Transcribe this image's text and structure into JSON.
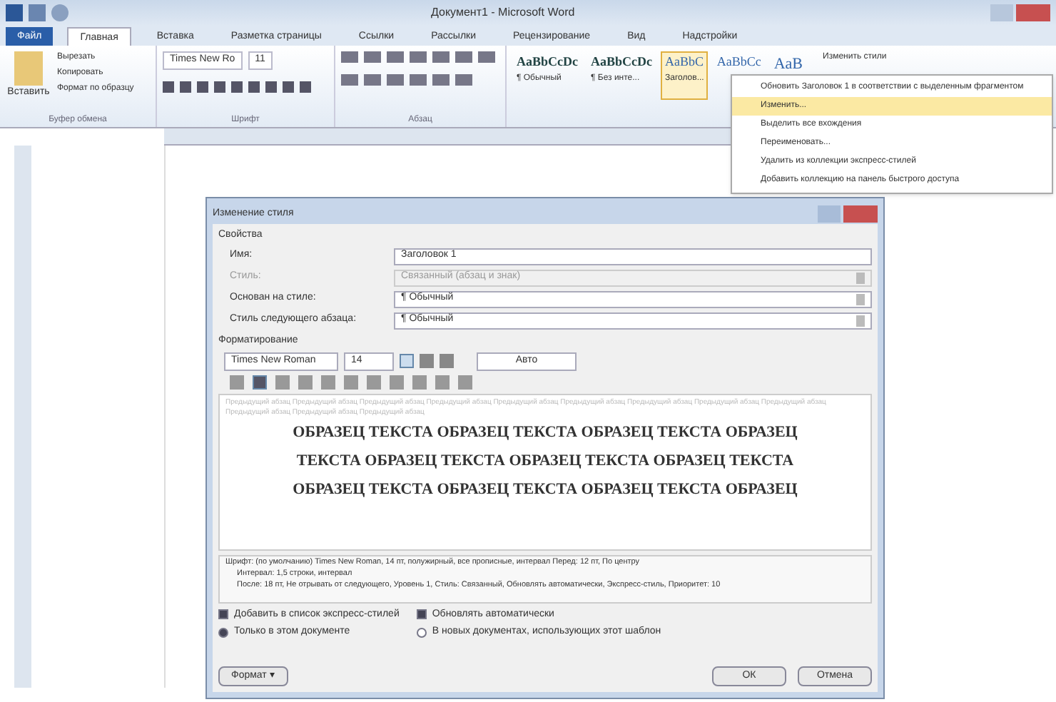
{
  "window": {
    "title": "Документ1 - Microsoft Word"
  },
  "ribbon_tabs": [
    {
      "label": "Файл",
      "selected": false,
      "kind": "file"
    },
    {
      "label": "Главная",
      "selected": true,
      "kind": "tab"
    },
    {
      "label": "Вставка",
      "selected": false,
      "kind": "tab"
    },
    {
      "label": "Разметка страницы",
      "selected": false,
      "kind": "tab"
    },
    {
      "label": "Ссылки",
      "selected": false,
      "kind": "tab"
    },
    {
      "label": "Рассылки",
      "selected": false,
      "kind": "tab"
    },
    {
      "label": "Рецензирование",
      "selected": false,
      "kind": "tab"
    },
    {
      "label": "Вид",
      "selected": false,
      "kind": "tab"
    },
    {
      "label": "Надстройки",
      "selected": false,
      "kind": "tab"
    }
  ],
  "clipboard": {
    "paste": "Вставить",
    "items": [
      "Вырезать",
      "Копировать",
      "Формат по образцу"
    ],
    "group": "Буфер обмена"
  },
  "font_group": {
    "font": "Times New Ro",
    "size": "11",
    "group": "Шрифт"
  },
  "paragraph_group": {
    "group": "Абзац"
  },
  "styles": [
    {
      "sample": "AaBbCcDc",
      "label": "¶ Обычный",
      "selected": false
    },
    {
      "sample": "AaBbCcDc",
      "label": "¶ Без инте...",
      "selected": false
    },
    {
      "sample": "AaBbC",
      "label": "Заголов...",
      "selected": true
    },
    {
      "sample": "AaBbCc",
      "selected": false
    },
    {
      "sample": "AaB",
      "selected": false
    }
  ],
  "change_styles": "Изменить стили",
  "context_menu": [
    {
      "label": "Обновить Заголовок 1 в соответствии с выделенным фрагментом",
      "selected": false
    },
    {
      "label": "Изменить...",
      "selected": true
    },
    {
      "label": "Выделить все вхождения",
      "selected": false
    },
    {
      "label": "Переименовать...",
      "selected": false
    },
    {
      "label": "Удалить из коллекции экспресс-стилей",
      "selected": false
    },
    {
      "label": "Добавить коллекцию на панель быстрого доступа",
      "selected": false
    }
  ],
  "dialog": {
    "title": "Изменение стиля",
    "properties_label": "Свойства",
    "fields": [
      {
        "label": "Имя:",
        "value": "Заголовок 1",
        "kind": "text",
        "disabled": false
      },
      {
        "label": "Стиль:",
        "value": "Связанный (абзац и знак)",
        "kind": "select",
        "disabled": true
      },
      {
        "label": "Основан на стиле:",
        "value": "¶ Обычный",
        "kind": "select",
        "disabled": false
      },
      {
        "label": "Стиль следующего абзаца:",
        "value": "¶ Обычный",
        "kind": "select",
        "disabled": false
      }
    ],
    "formatting_label": "Форматирование",
    "font": "Times New Roman",
    "size": "14",
    "bold": true,
    "italic": false,
    "underline": false,
    "font_color": "Авто",
    "align": [
      {
        "selected": false
      },
      {
        "selected": true
      },
      {
        "selected": false
      },
      {
        "selected": false
      }
    ],
    "preview_before": "Предыдущий абзац Предыдущий абзац Предыдущий абзац Предыдущий абзац Предыдущий абзац Предыдущий абзац Предыдущий абзац Предыдущий абзац Предыдущий абзац Предыдущий абзац Предыдущий абзац Предыдущий абзац",
    "preview_sample": [
      "ОБРАЗЕЦ ТЕКСТА ОБРАЗЕЦ ТЕКСТА ОБРАЗЕЦ ТЕКСТА ОБРАЗЕЦ",
      "ТЕКСТА ОБРАЗЕЦ ТЕКСТА ОБРАЗЕЦ ТЕКСТА ОБРАЗЕЦ ТЕКСТА",
      "ОБРАЗЕЦ ТЕКСТА ОБРАЗЕЦ ТЕКСТА ОБРАЗЕЦ ТЕКСТА ОБРАЗЕЦ"
    ],
    "description": [
      "Шрифт: (по умолчанию) Times New Roman, 14 пт, полужирный, все прописные, интервал Перед: 12 пт, По центру",
      "Интервал: 1,5 строки, интервал",
      "После: 18 пт, Не отрывать от следующего, Уровень 1, Стиль: Связанный, Обновлять автоматически, Экспресс-стиль, Приоритет: 10"
    ],
    "options": [
      {
        "label": "Добавить в список экспресс-стилей",
        "checked": true,
        "kind": "checkbox"
      },
      {
        "label": "Обновлять автоматически",
        "checked": true,
        "kind": "checkbox"
      },
      {
        "label": "Только в этом документе",
        "checked": true,
        "kind": "radio"
      },
      {
        "label": "В новых документах, использующих этот шаблон",
        "checked": false,
        "kind": "radio"
      }
    ],
    "format_button": "Формат ▾",
    "buttons": [
      "ОК",
      "Отмена"
    ]
  }
}
